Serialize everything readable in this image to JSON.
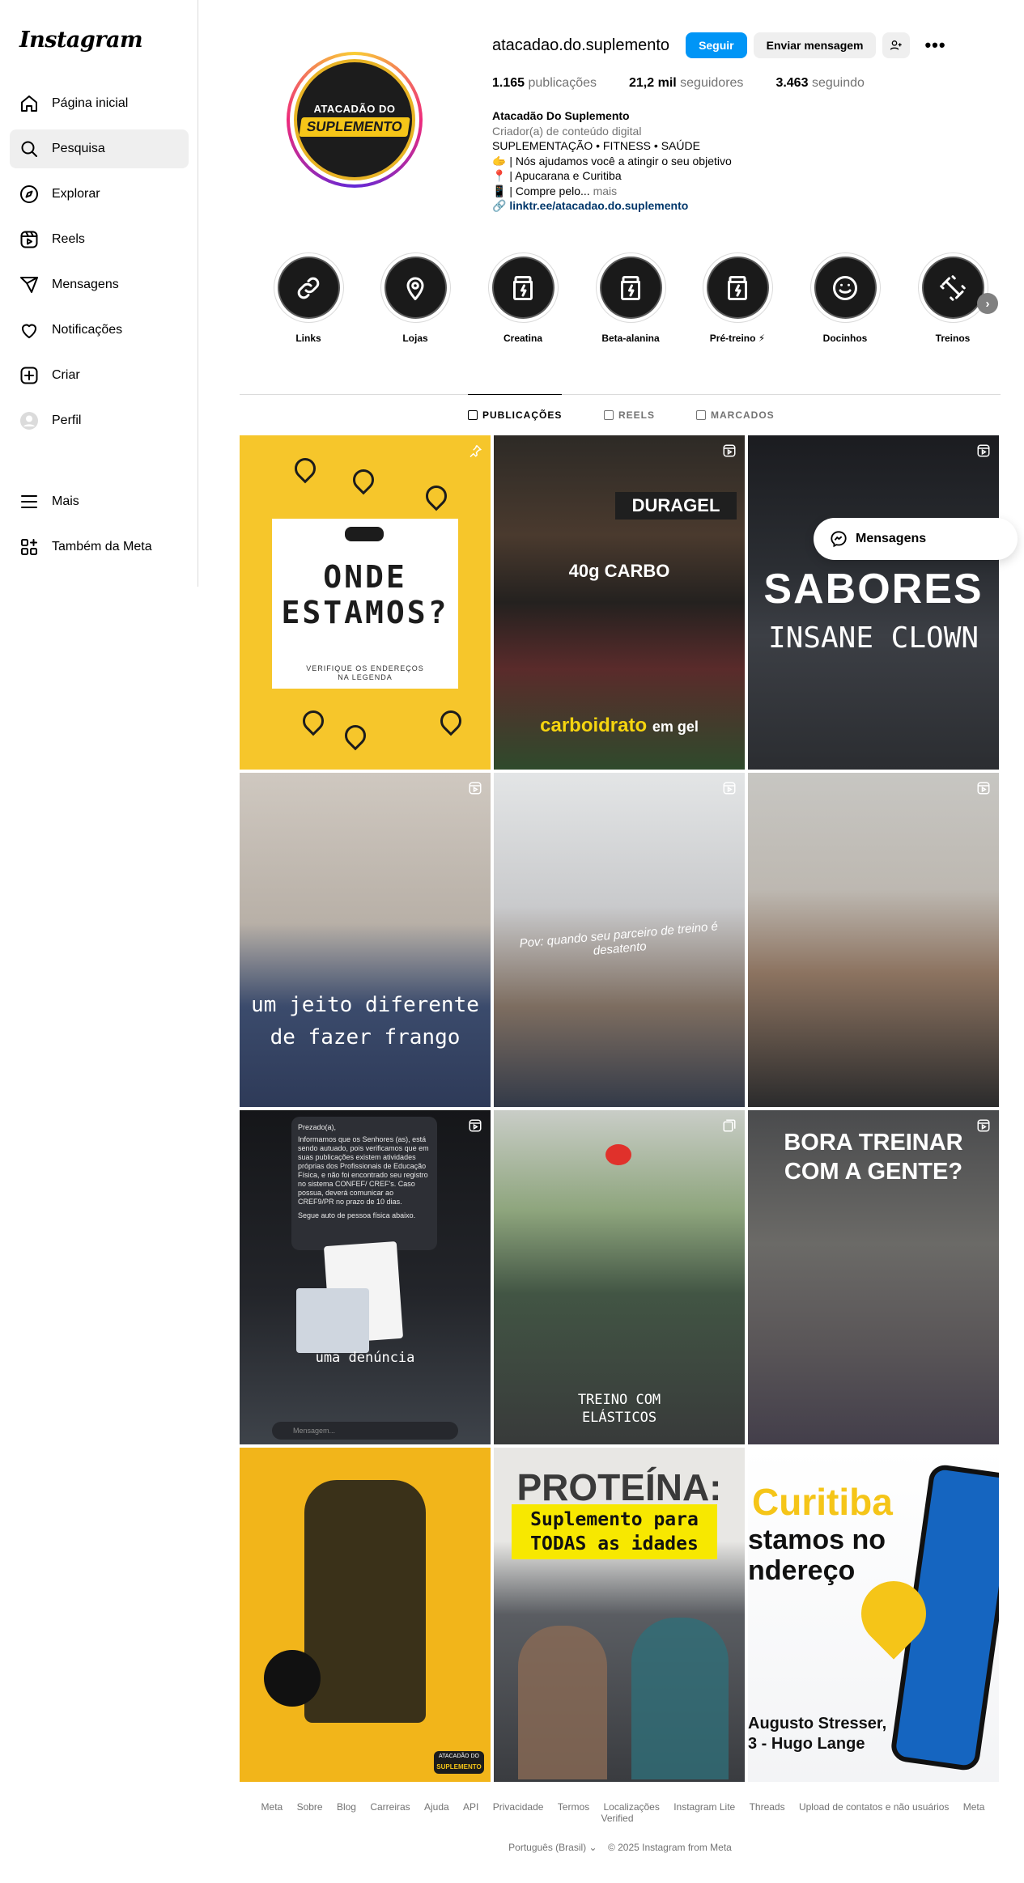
{
  "app": {
    "logo": "Instagram"
  },
  "sidebar": {
    "items": [
      {
        "label": "Página inicial",
        "icon": "home-icon"
      },
      {
        "label": "Pesquisa",
        "icon": "search-icon"
      },
      {
        "label": "Explorar",
        "icon": "compass-icon"
      },
      {
        "label": "Reels",
        "icon": "reels-icon"
      },
      {
        "label": "Mensagens",
        "icon": "send-icon"
      },
      {
        "label": "Notificações",
        "icon": "heart-icon"
      },
      {
        "label": "Criar",
        "icon": "plus-square-icon"
      },
      {
        "label": "Perfil",
        "icon": "profile-avatar-icon"
      }
    ],
    "bottom": [
      {
        "label": "Mais",
        "icon": "menu-icon"
      },
      {
        "label": "Também da Meta",
        "icon": "meta-apps-icon"
      }
    ]
  },
  "profile": {
    "username": "atacadao.do.suplemento",
    "follow_label": "Seguir",
    "message_label": "Enviar mensagem",
    "avatar_text_top": "ATACADÃO DO",
    "avatar_text_bottom": "SUPLEMENTO",
    "stats": {
      "posts_value": "1.165",
      "posts_label": "publicações",
      "followers_value": "21,2 mil",
      "followers_label": "seguidores",
      "following_value": "3.463",
      "following_label": "seguindo"
    },
    "bio": {
      "name": "Atacadão Do Suplemento",
      "category": "Criador(a) de conteúdo digital",
      "line1": "SUPLEMENTAÇÃO • FITNESS • SAÚDE",
      "line2": "🫱 | Nós ajudamos você a atingir o seu objetivo",
      "line3": "📍 | Apucarana e Curitiba",
      "line4": "📱 | Compre pelo...",
      "more": "mais",
      "link": "linktr.ee/atacadao.do.suplemento"
    }
  },
  "highlights": [
    {
      "label": "Links",
      "icon": "link-icon"
    },
    {
      "label": "Lojas",
      "icon": "map-pin-icon"
    },
    {
      "label": "Creatina",
      "icon": "supplement-jar-icon"
    },
    {
      "label": "Beta-alanina",
      "icon": "supplement-jar-icon"
    },
    {
      "label": "Pré-treino ⚡",
      "icon": "supplement-jar-icon"
    },
    {
      "label": "Docinhos",
      "icon": "smile-icon"
    },
    {
      "label": "Treinos",
      "icon": "dumbbell-icon"
    }
  ],
  "tabs": [
    {
      "label": "PUBLICAÇÕES",
      "active": true
    },
    {
      "label": "REELS",
      "active": false
    },
    {
      "label": "MARCADOS",
      "active": false
    }
  ],
  "posts": [
    {
      "text1": "ONDE",
      "text2": "ESTAMOS?",
      "sub": "VERIFIQUE OS ENDEREÇOS NA LEGENDA",
      "badge": "pin-icon"
    },
    {
      "text1": "DURAGEL",
      "text2": "40g CARBO",
      "caption_a": "carboidrato",
      "caption_b": "em gel",
      "badge": "reel-icon"
    },
    {
      "text1": "SABORES",
      "text2": "INSANE CLOWN",
      "badge": "reel-icon"
    },
    {
      "text1": "um jeito diferente",
      "text2": "de fazer frango",
      "badge": "reel-icon"
    },
    {
      "text1": "Pov: quando seu parceiro de treino é desatento",
      "badge": "reel-icon"
    },
    {
      "badge": "reel-icon"
    },
    {
      "text1": "Prezado(a),",
      "text2": "Informamos que os Senhores (as), está sendo autuado, pois verificamos que em suas publicações existem atividades próprias dos Profissionais de Educação Física, e não foi encontrado seu registro no sistema CONFEF/ CREF's. Caso possua, deverá comunicar ao CREF9/PR no prazo de 10 dias.",
      "text3": "Segue auto de pessoa física abaixo.",
      "caption": "uma denúncia",
      "input": "Mensagem...",
      "badge": "reel-icon"
    },
    {
      "text1": "TREINO COM",
      "text2": "ELÁSTICOS",
      "badge": "carousel-icon"
    },
    {
      "text1": "BORA TREINAR",
      "text2": "COM A GENTE?",
      "badge": "reel-icon"
    },
    {
      "brand_top": "ATACADÃO DO",
      "brand_bottom": "SUPLEMENTO"
    },
    {
      "text1": "PROTEÍNA:",
      "text2": "Suplemento para",
      "text3": "TODAS as idades"
    },
    {
      "text1": "Curitiba",
      "text2": "stamos no",
      "text3": "ndereço",
      "text4": "Augusto Stresser,",
      "text5": "3 - Hugo Lange"
    }
  ],
  "floating": {
    "messages_label": "Mensagens"
  },
  "footer": {
    "links": [
      "Meta",
      "Sobre",
      "Blog",
      "Carreiras",
      "Ajuda",
      "API",
      "Privacidade",
      "Termos",
      "Localizações",
      "Instagram Lite",
      "Threads",
      "Upload de contatos e não usuários",
      "Meta Verified"
    ],
    "language": "Português (Brasil)",
    "copyright": "© 2025 Instagram from Meta"
  }
}
